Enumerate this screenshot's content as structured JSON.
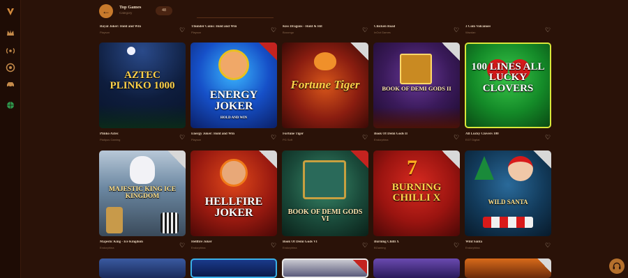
{
  "header": {
    "back_icon": "arrow-left-icon",
    "title": "Top Games",
    "subtitle": "Category",
    "count": "48"
  },
  "sidebar": {
    "items": [
      {
        "icon": "logo-icon"
      },
      {
        "icon": "crown-icon"
      },
      {
        "icon": "broadcast-icon"
      },
      {
        "icon": "chip-icon"
      },
      {
        "icon": "car-icon"
      },
      {
        "icon": "globe-icon"
      }
    ]
  },
  "top_row": [
    {
      "name": "Royal Joker: Hold and Win",
      "provider": "Playson"
    },
    {
      "name": "Thunder Coins: Hold and Win",
      "provider": "Playson"
    },
    {
      "name": "Kiss Dragons - Hold & Hit",
      "provider": "Booongo"
    },
    {
      "name": "Chicken Road",
      "provider": "InOut Games"
    },
    {
      "name": "3 Coin Volcanoes",
      "provider": "Wazdan"
    }
  ],
  "row1": [
    {
      "art_title": "AZTEC PLINKO 1000",
      "name": "Plinko Aztec",
      "provider": "Platipus Gaming"
    },
    {
      "art_title": "ENERGY JOKER",
      "art_sub": "HOLD AND WIN",
      "name": "Energy Joker: Hold and Win",
      "provider": "Playson"
    },
    {
      "art_title": "Fortune Tiger",
      "name": "Fortune Tiger",
      "provider": "PG Soft"
    },
    {
      "art_title": "BOOK OF DEMI GODS II",
      "name": "Book Of Demi Gods II",
      "provider": "Endorphina"
    },
    {
      "art_title": "100 LINES ALL LUCKY CLOVERS",
      "name": "All Lucky Clovers 100",
      "provider": "EGT Digital"
    }
  ],
  "row2": [
    {
      "art_title": "MAJESTIC KING ICE KINGDOM",
      "name": "Majestic King - Ice Kingdom",
      "provider": "Endorphina"
    },
    {
      "art_title": "HELLFIRE JOKER",
      "name": "Hellfire Joker",
      "provider": "Endorphina"
    },
    {
      "art_title": "BOOK OF DEMI GODS VI",
      "name": "Book Of Demi Gods VI",
      "provider": "Endorphina"
    },
    {
      "art_title": "BURNING CHILLI X",
      "name": "Burning Chilli X",
      "provider": "BGaming"
    },
    {
      "art_title": "WILD SANTA",
      "name": "Wild Santa",
      "provider": "Endorphina"
    }
  ],
  "support": {
    "icon": "headset-icon"
  }
}
